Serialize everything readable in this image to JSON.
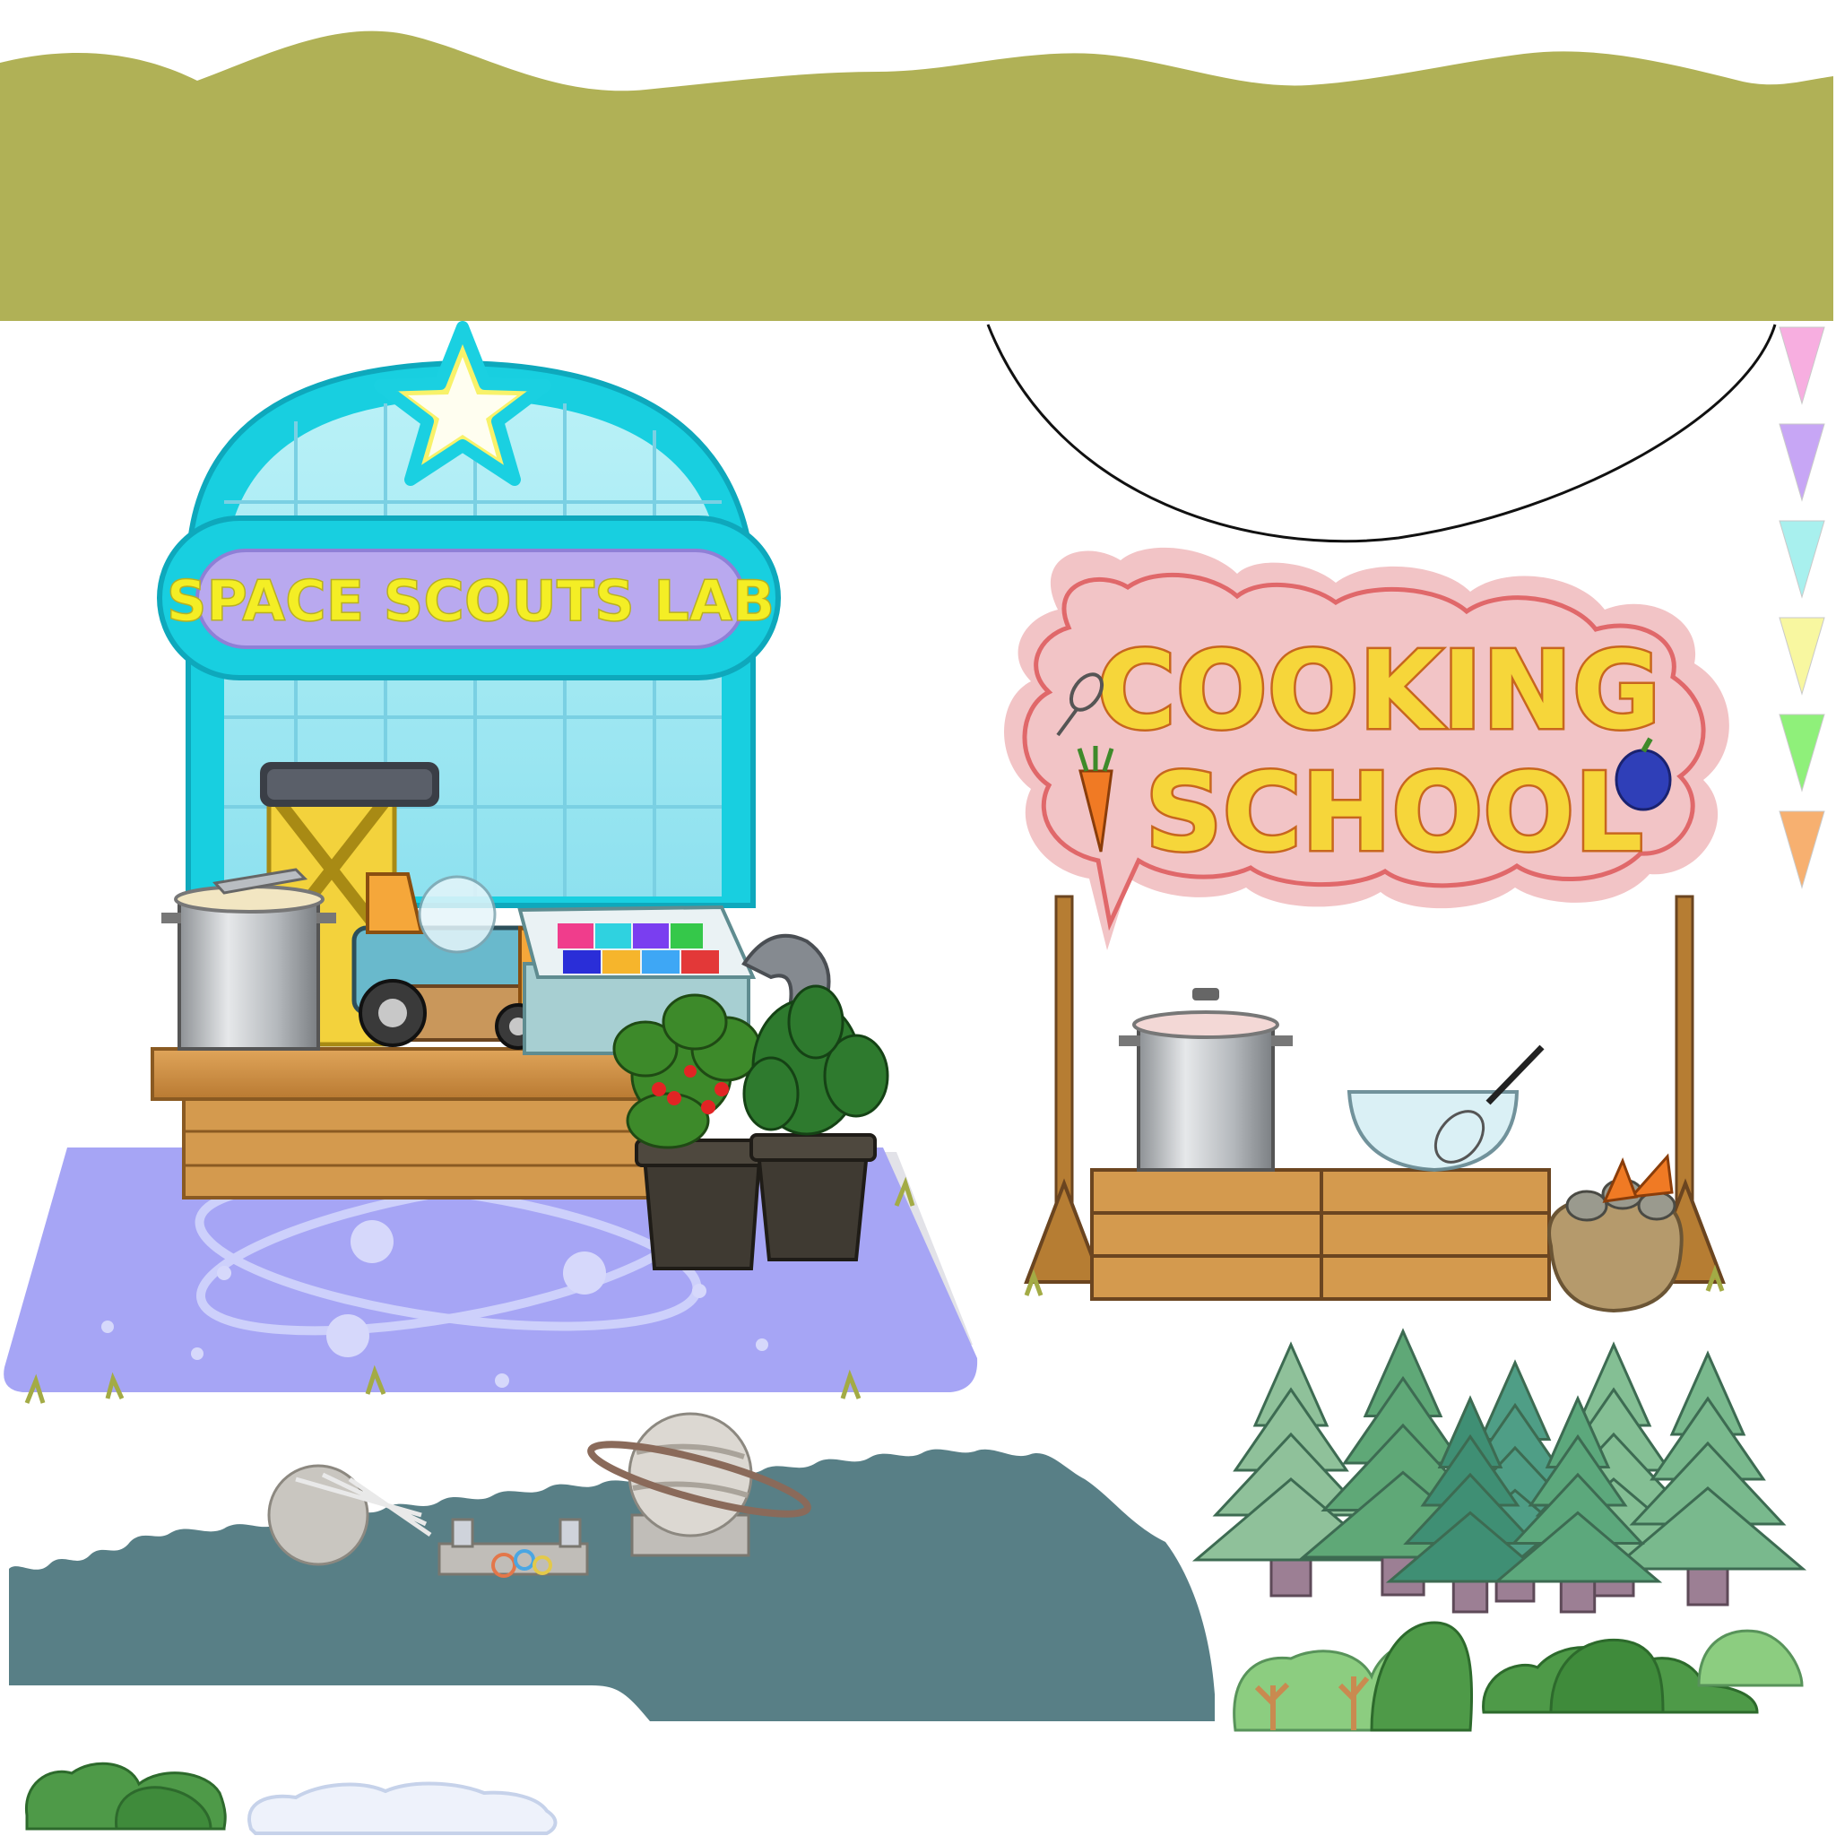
{
  "space_scouts_lab": {
    "sign_text": "SPACE SCOUTS LAB"
  },
  "cooking_school": {
    "sign_line_1": "COOKING",
    "sign_line_2": "SCHOOL"
  },
  "bunting_colors": [
    "#f7aee0",
    "#c7a6f5",
    "#a8f0ee",
    "#f8f7a0",
    "#8ff07a",
    "#f7b070"
  ],
  "colors": {
    "hill_top": "#b0b156",
    "lab_frame": "#18cfe0",
    "lab_sign_bg": "#b9a9ef",
    "lab_floor": "#a6a5f5",
    "cooking_cloud": "#f2c4c6",
    "forest_dark": "#587f86"
  }
}
